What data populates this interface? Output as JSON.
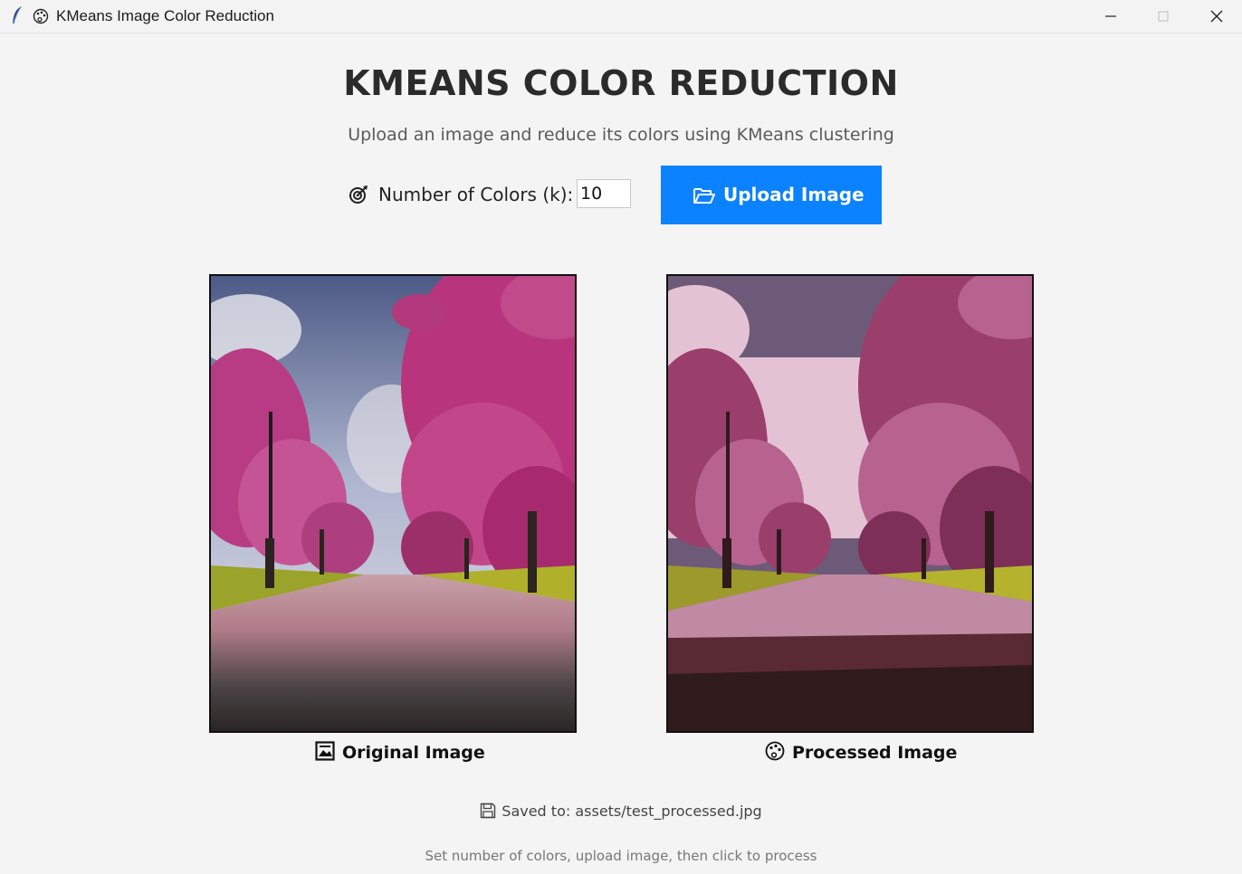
{
  "window": {
    "title": "KMeans Image Color Reduction",
    "icons": [
      "feather-icon",
      "palette-icon"
    ],
    "controls": [
      "minimize",
      "maximize",
      "close"
    ]
  },
  "header": {
    "title": "KMEANS COLOR REDUCTION",
    "subtitle": "Upload an image and reduce its colors using KMeans clustering"
  },
  "controls": {
    "k_icon": "target-icon",
    "k_label": "Number of Colors (k):",
    "k_value": "10",
    "upload_icon": "folder-open-icon",
    "upload_label": "Upload Image",
    "accent": "#0b82ff"
  },
  "images": {
    "original_caption": "Original Image",
    "original_icon": "picture-icon",
    "processed_caption": "Processed Image",
    "processed_icon": "palette-icon"
  },
  "status": {
    "save_icon": "floppy-disk-icon",
    "saved_text": "Saved to: assets/test_processed.jpg",
    "hint_text": "Set number of colors, upload image, then click to process"
  }
}
